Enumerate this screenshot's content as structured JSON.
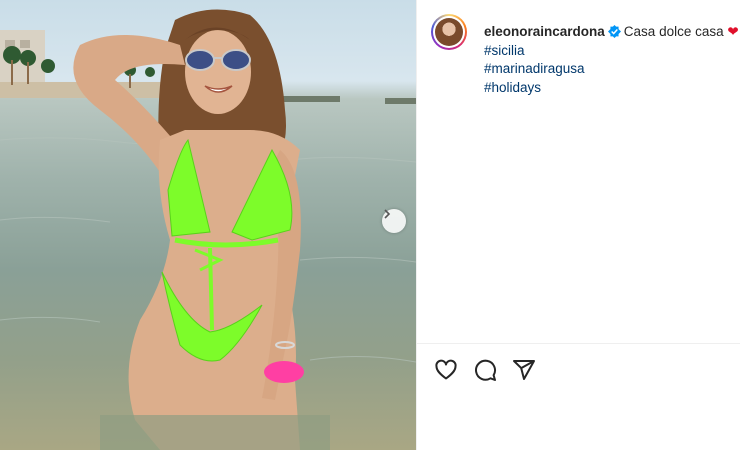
{
  "post": {
    "username": "eleonoraincardona",
    "caption_text": "Casa dolce casa",
    "caption_emoji": "❤",
    "hashtags": [
      "#sicilia",
      "#marinadiragusa",
      "#holidays"
    ]
  },
  "icons": {
    "verified": "verified-badge-icon",
    "next": "chevron-right-icon",
    "like": "heart-icon",
    "comment": "comment-icon",
    "share": "paper-plane-icon"
  },
  "colors": {
    "hashtag": "#00376b",
    "verified": "#0095f6",
    "bikini": "#7dfc2a",
    "scrunchie": "#ff3fa3"
  }
}
